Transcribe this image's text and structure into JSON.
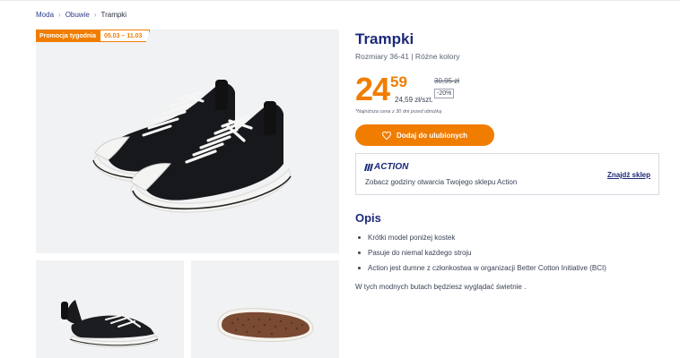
{
  "breadcrumb": {
    "items": [
      "Moda",
      "Obuwie"
    ],
    "current": "Trampki"
  },
  "promo": {
    "label": "Promocja tygodnia",
    "dates": "05.03 – 11.03"
  },
  "product": {
    "title": "Trampki",
    "subtitle": "Rozmiary 36-41 | Różne kolory",
    "price_whole": "24",
    "price_cents": "59",
    "unit_price": "24,59 zł/szt.",
    "old_price": "30,95 zł",
    "discount": "-20%",
    "lowest_note": "*Najniższa cena z 30 dni przed obniżką"
  },
  "favorite_button": {
    "label": "Dodaj do ulubionych",
    "icon": "heart-icon"
  },
  "store": {
    "logo_text": "ACTION",
    "info": "Zobacz godziny otwarcia Twojego sklepu Action",
    "link": "Znajdź sklep"
  },
  "description": {
    "heading": "Opis",
    "bullets": [
      "Krótki model poniżej kostek",
      "Pasuje do niemal każdego stroju",
      "Action jest dumne z członkostwa w organizacji Better Cotton Initiative (BCI)"
    ],
    "paragraph": "W tych modnych butach będziesz wyglądać świetnie ."
  },
  "colors": {
    "accent": "#f07d00",
    "brand": "#1b2a78",
    "image_bg": "#f1f2f4"
  }
}
